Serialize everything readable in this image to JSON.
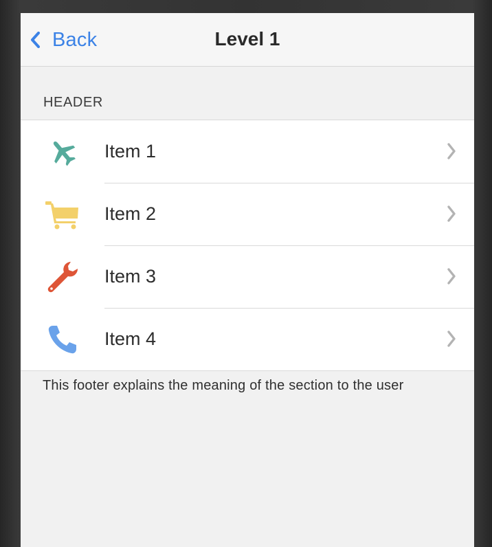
{
  "navbar": {
    "back_label": "Back",
    "title": "Level 1"
  },
  "section": {
    "header": "HEADER",
    "footer": "This footer explains the meaning of the section to the user",
    "items": [
      {
        "label": "Item 1",
        "icon": "airplane-icon",
        "color": "#56ab9c"
      },
      {
        "label": "Item 2",
        "icon": "cart-icon",
        "color": "#f3d06a"
      },
      {
        "label": "Item 3",
        "icon": "wrench-icon",
        "color": "#de5537"
      },
      {
        "label": "Item 4",
        "icon": "phone-icon",
        "color": "#6aa2ea"
      }
    ]
  },
  "colors": {
    "accent": "#3b82e6",
    "background": "#f1f1f1"
  }
}
